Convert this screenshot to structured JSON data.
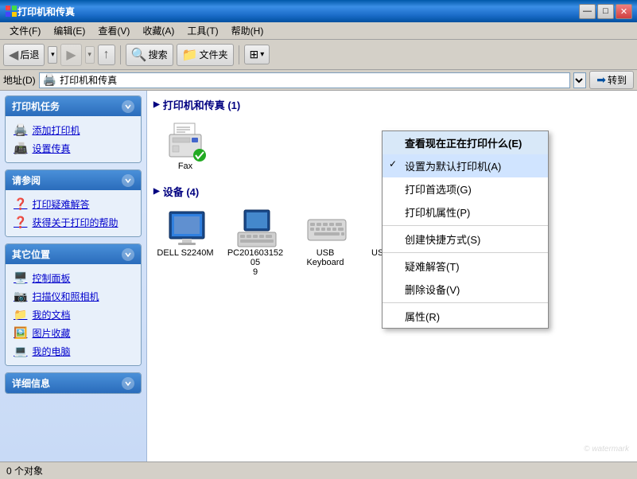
{
  "window": {
    "title": "打印机和传真",
    "icon": "🖨️"
  },
  "titlebar": {
    "min_btn": "—",
    "max_btn": "□",
    "close_btn": "✕"
  },
  "menubar": {
    "items": [
      {
        "label": "文件(F)",
        "id": "file"
      },
      {
        "label": "编辑(E)",
        "id": "edit"
      },
      {
        "label": "查看(V)",
        "id": "view"
      },
      {
        "label": "收藏(A)",
        "id": "favorites"
      },
      {
        "label": "工具(T)",
        "id": "tools"
      },
      {
        "label": "帮助(H)",
        "id": "help"
      }
    ]
  },
  "toolbar": {
    "back_label": "后退",
    "forward_label": "前进",
    "up_label": "上移",
    "search_label": "搜索",
    "folders_label": "文件夹",
    "views_label": ""
  },
  "addressbar": {
    "label": "地址(D)",
    "path_icon": "🖨️",
    "path_text": "打印机和传真",
    "go_label": "转到",
    "go_icon": "➡"
  },
  "sidebar": {
    "sections": [
      {
        "id": "printer-tasks",
        "header": "打印机任务",
        "items": [
          {
            "id": "add-printer",
            "label": "添加打印机",
            "icon": "🖨️"
          },
          {
            "id": "setup-fax",
            "label": "设置传真",
            "icon": "📠"
          }
        ]
      },
      {
        "id": "see-also",
        "header": "请参阅",
        "items": [
          {
            "id": "troubleshoot",
            "label": "打印疑难解答",
            "icon": "❓"
          },
          {
            "id": "help",
            "label": "获得关于打印的帮助",
            "icon": "❓"
          }
        ]
      },
      {
        "id": "other-places",
        "header": "其它位置",
        "items": [
          {
            "id": "control-panel",
            "label": "控制面板",
            "icon": "🖥️"
          },
          {
            "id": "scanner-camera",
            "label": "扫描仪和照相机",
            "icon": "📷"
          },
          {
            "id": "my-documents",
            "label": "我的文档",
            "icon": "📁"
          },
          {
            "id": "my-pictures",
            "label": "图片收藏",
            "icon": "🖼️"
          },
          {
            "id": "my-computer",
            "label": "我的电脑",
            "icon": "💻"
          }
        ]
      },
      {
        "id": "details",
        "header": "详细信息",
        "items": []
      }
    ]
  },
  "content": {
    "printers_title": "打印机和传真 (1)",
    "devices_title": "设备 (4)",
    "printers": [
      {
        "id": "fax",
        "label": "Fax",
        "type": "fax",
        "default": true
      }
    ],
    "devices": [
      {
        "id": "dell-monitor",
        "label": "DELL S2240M",
        "type": "monitor"
      },
      {
        "id": "pc",
        "label": "PC20160315205\n9",
        "type": "computer"
      },
      {
        "id": "keyboard",
        "label": "USB Keyboard",
        "type": "keyboard"
      },
      {
        "id": "mouse",
        "label": "USB Optical Mouse",
        "type": "mouse"
      }
    ]
  },
  "context_menu": {
    "items": [
      {
        "id": "see-printing",
        "label": "查看现在正在打印什么(E)",
        "bold": true,
        "separator_after": false
      },
      {
        "id": "set-default",
        "label": "设置为默认打印机(A)",
        "checked": true,
        "separator_after": false
      },
      {
        "id": "printing-prefs",
        "label": "打印首选项(G)",
        "separator_after": false
      },
      {
        "id": "printer-props",
        "label": "打印机属性(P)",
        "separator_after": true
      },
      {
        "id": "create-shortcut",
        "label": "创建快捷方式(S)",
        "separator_after": true
      },
      {
        "id": "troubleshoot",
        "label": "疑难解答(T)",
        "separator_after": false
      },
      {
        "id": "delete",
        "label": "删除设备(V)",
        "separator_after": true
      },
      {
        "id": "properties",
        "label": "属性(R)",
        "separator_after": false
      }
    ]
  },
  "statusbar": {
    "text": "0 个对象"
  }
}
